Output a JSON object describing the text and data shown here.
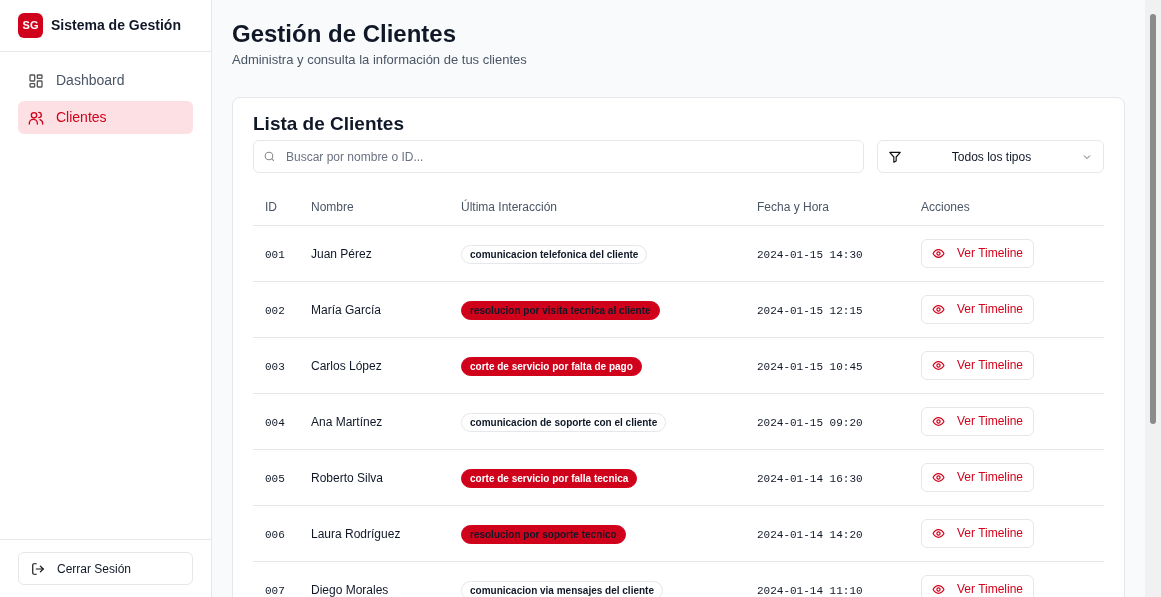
{
  "brand": {
    "logo": "SG",
    "name": "Sistema de Gestión"
  },
  "sidebar": {
    "items": [
      {
        "label": "Dashboard",
        "selected": false
      },
      {
        "label": "Clientes",
        "selected": true
      }
    ],
    "logout": "Cerrar Sesión"
  },
  "page": {
    "title": "Gestión de Clientes",
    "subtitle": "Administra y consulta la información de tus clientes"
  },
  "card": {
    "title": "Lista de Clientes",
    "search": {
      "placeholder": "Buscar por nombre o ID..."
    },
    "filter": {
      "value": "Todos los tipos"
    },
    "table": {
      "columns": [
        "ID",
        "Nombre",
        "Última Interacción",
        "Fecha y Hora",
        "Acciones"
      ],
      "rows": [
        {
          "id": "001",
          "name": "Juan Pérez",
          "interaction": {
            "text": "comunicacion telefonica del cliente",
            "kind": "outline"
          },
          "datetime": "2024-01-15 14:30",
          "action": "Ver Timeline"
        },
        {
          "id": "002",
          "name": "María García",
          "interaction": {
            "text": "resolucion por visita tecnica al cliente",
            "kind": "dark"
          },
          "datetime": "2024-01-15 12:15",
          "action": "Ver Timeline"
        },
        {
          "id": "003",
          "name": "Carlos López",
          "interaction": {
            "text": "corte de servicio por falta de pago",
            "kind": "solid"
          },
          "datetime": "2024-01-15 10:45",
          "action": "Ver Timeline"
        },
        {
          "id": "004",
          "name": "Ana Martínez",
          "interaction": {
            "text": "comunicacion de soporte con el cliente",
            "kind": "outline"
          },
          "datetime": "2024-01-15 09:20",
          "action": "Ver Timeline"
        },
        {
          "id": "005",
          "name": "Roberto Silva",
          "interaction": {
            "text": "corte de servicio por falla tecnica",
            "kind": "solid"
          },
          "datetime": "2024-01-14 16:30",
          "action": "Ver Timeline"
        },
        {
          "id": "006",
          "name": "Laura Rodríguez",
          "interaction": {
            "text": "resolucion por soporte tecnico",
            "kind": "dark"
          },
          "datetime": "2024-01-14 14:20",
          "action": "Ver Timeline"
        },
        {
          "id": "007",
          "name": "Diego Morales",
          "interaction": {
            "text": "comunicacion via mensajes del cliente",
            "kind": "outline"
          },
          "datetime": "2024-01-14 11:10",
          "action": "Ver Timeline"
        }
      ]
    }
  }
}
